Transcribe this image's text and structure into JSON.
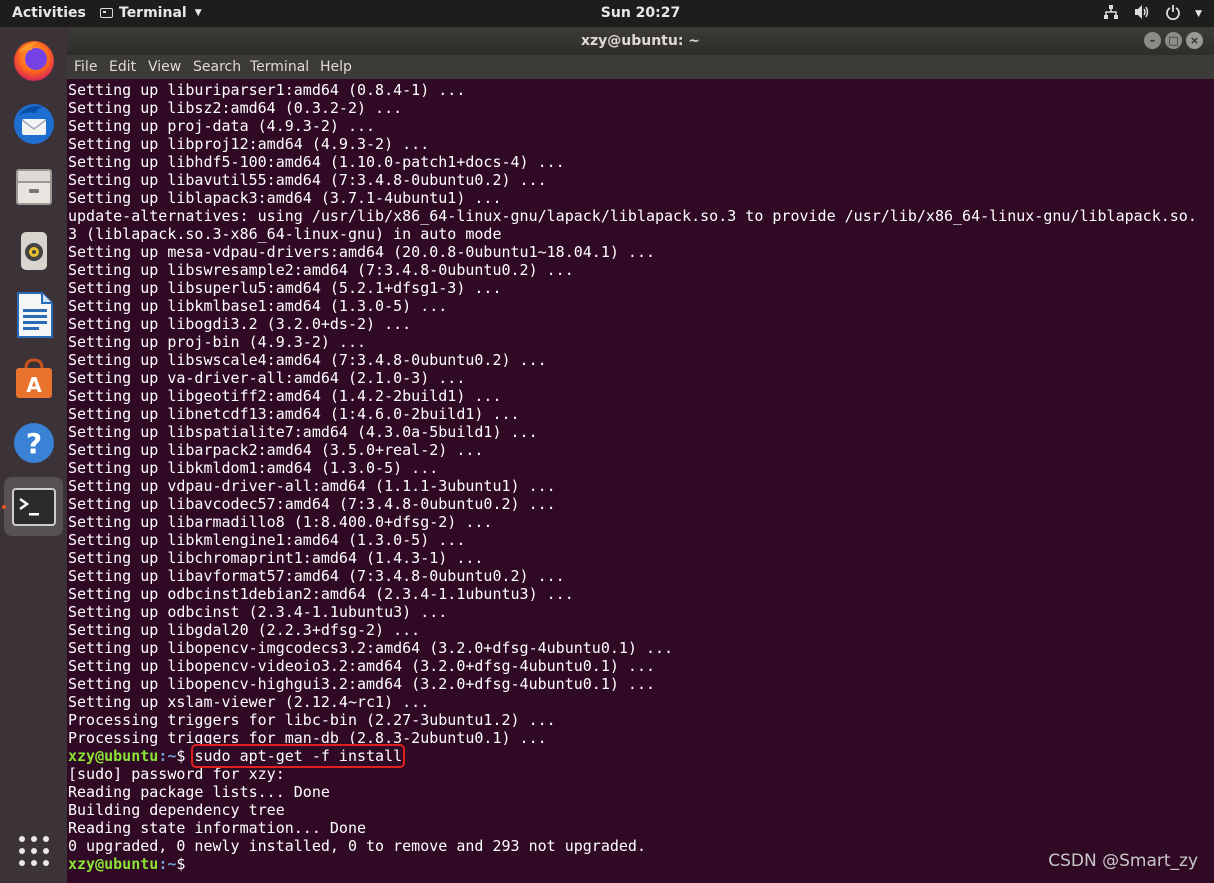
{
  "topbar": {
    "activities": "Activities",
    "app_menu": "Terminal",
    "clock": "Sun 20:27"
  },
  "window": {
    "title": "xzy@ubuntu: ~",
    "menu": [
      "File",
      "Edit",
      "View",
      "Search",
      "Terminal",
      "Help"
    ]
  },
  "dock": {
    "items": [
      "firefox-icon",
      "thunderbird-icon",
      "files-icon",
      "rhythmbox-icon",
      "libreoffice-writer-icon",
      "software-center-icon",
      "help-icon",
      "terminal-icon"
    ],
    "show_apps": "show-applications-icon"
  },
  "terminal": {
    "output_lines": [
      "Setting up liburiparser1:amd64 (0.8.4-1) ...",
      "Setting up libsz2:amd64 (0.3.2-2) ...",
      "Setting up proj-data (4.9.3-2) ...",
      "Setting up libproj12:amd64 (4.9.3-2) ...",
      "Setting up libhdf5-100:amd64 (1.10.0-patch1+docs-4) ...",
      "Setting up libavutil55:amd64 (7:3.4.8-0ubuntu0.2) ...",
      "Setting up liblapack3:amd64 (3.7.1-4ubuntu1) ...",
      "update-alternatives: using /usr/lib/x86_64-linux-gnu/lapack/liblapack.so.3 to provide /usr/lib/x86_64-linux-gnu/liblapack.so.",
      "3 (liblapack.so.3-x86_64-linux-gnu) in auto mode",
      "Setting up mesa-vdpau-drivers:amd64 (20.0.8-0ubuntu1~18.04.1) ...",
      "Setting up libswresample2:amd64 (7:3.4.8-0ubuntu0.2) ...",
      "Setting up libsuperlu5:amd64 (5.2.1+dfsg1-3) ...",
      "Setting up libkmlbase1:amd64 (1.3.0-5) ...",
      "Setting up libogdi3.2 (3.2.0+ds-2) ...",
      "Setting up proj-bin (4.9.3-2) ...",
      "Setting up libswscale4:amd64 (7:3.4.8-0ubuntu0.2) ...",
      "Setting up va-driver-all:amd64 (2.1.0-3) ...",
      "Setting up libgeotiff2:amd64 (1.4.2-2build1) ...",
      "Setting up libnetcdf13:amd64 (1:4.6.0-2build1) ...",
      "Setting up libspatialite7:amd64 (4.3.0a-5build1) ...",
      "Setting up libarpack2:amd64 (3.5.0+real-2) ...",
      "Setting up libkmldom1:amd64 (1.3.0-5) ...",
      "Setting up vdpau-driver-all:amd64 (1.1.1-3ubuntu1) ...",
      "Setting up libavcodec57:amd64 (7:3.4.8-0ubuntu0.2) ...",
      "Setting up libarmadillo8 (1:8.400.0+dfsg-2) ...",
      "Setting up libkmlengine1:amd64 (1.3.0-5) ...",
      "Setting up libchromaprint1:amd64 (1.4.3-1) ...",
      "Setting up libavformat57:amd64 (7:3.4.8-0ubuntu0.2) ...",
      "Setting up odbcinst1debian2:amd64 (2.3.4-1.1ubuntu3) ...",
      "Setting up odbcinst (2.3.4-1.1ubuntu3) ...",
      "Setting up libgdal20 (2.2.3+dfsg-2) ...",
      "Setting up libopencv-imgcodecs3.2:amd64 (3.2.0+dfsg-4ubuntu0.1) ...",
      "Setting up libopencv-videoio3.2:amd64 (3.2.0+dfsg-4ubuntu0.1) ...",
      "Setting up libopencv-highgui3.2:amd64 (3.2.0+dfsg-4ubuntu0.1) ...",
      "Setting up xslam-viewer (2.12.4~rc1) ...",
      "Processing triggers for libc-bin (2.27-3ubuntu1.2) ...",
      "Processing triggers for man-db (2.8.3-2ubuntu0.1) ..."
    ],
    "prompt_user": "xzy@ubuntu",
    "prompt_path": ":~",
    "prompt_symbol": "$ ",
    "command": "sudo apt-get -f install",
    "after_lines": [
      "[sudo] password for xzy:",
      "Reading package lists... Done",
      "Building dependency tree",
      "Reading state information... Done",
      "0 upgraded, 0 newly installed, 0 to remove and 293 not upgraded."
    ]
  },
  "watermark": "CSDN @Smart_zy"
}
